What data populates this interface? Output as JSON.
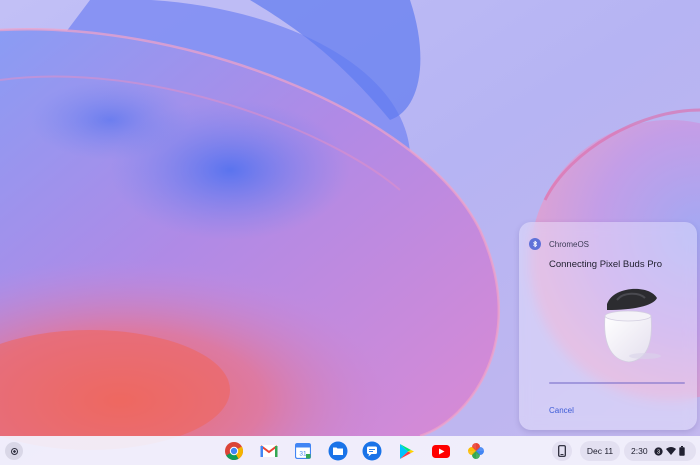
{
  "notification": {
    "app_name": "ChromeOS",
    "title": "Connecting Pixel Buds Pro",
    "cancel_label": "Cancel",
    "icon": "bluetooth-icon"
  },
  "shelf": {
    "launcher_icon": "launcher-icon",
    "apps": [
      {
        "name": "chrome-icon"
      },
      {
        "name": "gmail-icon"
      },
      {
        "name": "calendar-icon"
      },
      {
        "name": "files-icon"
      },
      {
        "name": "messages-icon"
      },
      {
        "name": "play-store-icon"
      },
      {
        "name": "youtube-icon"
      },
      {
        "name": "photos-icon"
      }
    ],
    "date": "Dec 11",
    "time": "2:30",
    "status_icons": [
      "notification-count-icon",
      "wifi-icon",
      "battery-icon"
    ],
    "notification_count": "3"
  },
  "colors": {
    "accent": "#3c5bd6",
    "wallpaper_base": "#b9b4f2"
  }
}
